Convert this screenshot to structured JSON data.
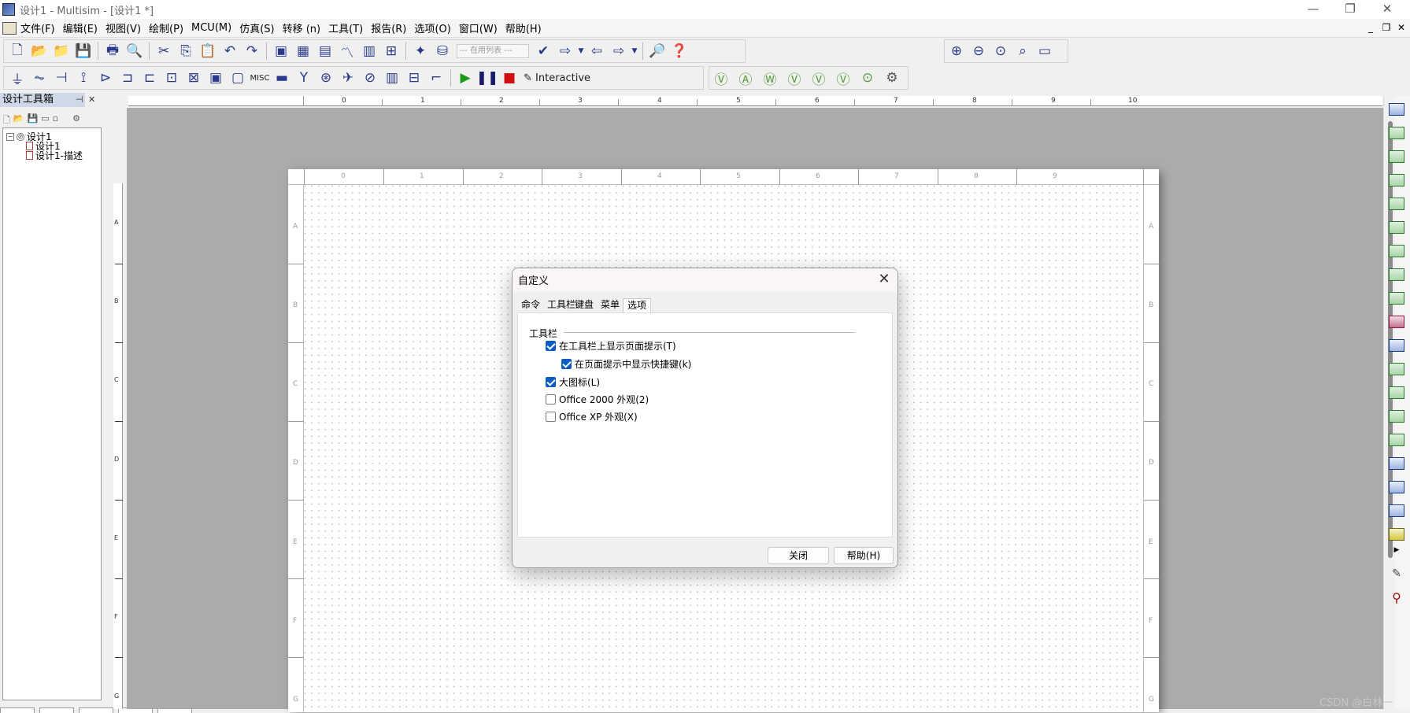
{
  "window": {
    "title": "设计1 - Multisim - [设计1 *]",
    "minimize": "—",
    "restore": "❐",
    "close": "✕"
  },
  "mdi": {
    "minimize": "_",
    "restore": "❐",
    "close": "✕"
  },
  "menu": [
    "文件(F)",
    "编辑(E)",
    "视图(V)",
    "绘制(P)",
    "MCU(M)",
    "仿真(S)",
    "转移 (n)",
    "工具(T)",
    "报告(R)",
    "选项(O)",
    "窗口(W)",
    "帮助(H)"
  ],
  "toolbar": {
    "in_use_list_placeholder": "--- 在用列表 ---",
    "interactive_label": "Interactive",
    "misc_label": "MISC"
  },
  "design_toolbox": {
    "title": "设计工具箱",
    "tree": [
      {
        "label": "设计1",
        "level": 0
      },
      {
        "label": "设计1",
        "level": 1
      },
      {
        "label": "设计1-描述",
        "level": 1
      }
    ]
  },
  "ruler": {
    "top_numbers": [
      "0",
      "1",
      "2",
      "3",
      "4",
      "5",
      "6",
      "7",
      "8",
      "9",
      "10"
    ],
    "sheet_numbers": [
      "0",
      "1",
      "2",
      "3",
      "4",
      "5",
      "6",
      "7",
      "8",
      "9"
    ],
    "row_letters": [
      "A",
      "B",
      "C",
      "D",
      "E",
      "F",
      "G"
    ]
  },
  "dialog": {
    "title": "自定义",
    "tabs": [
      "命令",
      "工具栏",
      "键盘",
      "菜单",
      "选项"
    ],
    "active_tab": "选项",
    "group_label": "工具栏",
    "options": [
      {
        "label": "在工具栏上显示页面提示(T)",
        "checked": true
      },
      {
        "label": "在页面提示中显示快捷键(k)",
        "checked": true
      },
      {
        "label": "大图标(L)",
        "checked": true
      },
      {
        "label": "Office 2000 外观(2)",
        "checked": false
      },
      {
        "label": "Office XP 外观(X)",
        "checked": false
      }
    ],
    "close_button": "关闭",
    "help_button": "帮助(H)"
  },
  "watermark": "CSDN @白林一"
}
